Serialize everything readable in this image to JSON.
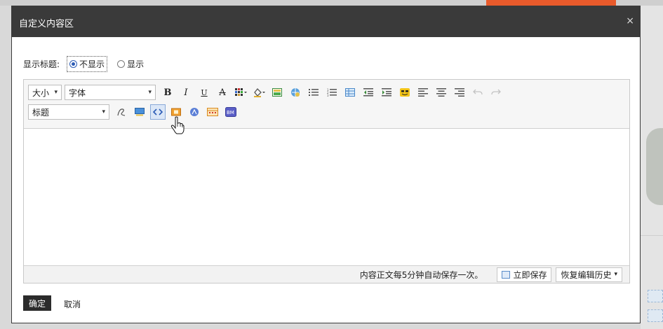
{
  "dialog": {
    "title": "自定义内容区",
    "close_symbol": "×"
  },
  "display_title": {
    "label": "显示标题:",
    "options": [
      "不显示",
      "显示"
    ],
    "selected": "不显示"
  },
  "toolbar": {
    "size_combo": "大小",
    "font_combo": "字体",
    "heading_combo": "标题",
    "bold": "B",
    "italic": "I",
    "underline": "U",
    "strike": "A"
  },
  "statusbar": {
    "autosave_note": "内容正文每5分钟自动保存一次。",
    "save_now": "立即保存",
    "restore_history": "恢复编辑历史"
  },
  "footer": {
    "ok": "确定",
    "cancel": "取消"
  },
  "colors": {
    "titlebar": "#3a3a3a",
    "accent_blue": "#2b5bb5",
    "background_orange": "#e85a2b"
  }
}
